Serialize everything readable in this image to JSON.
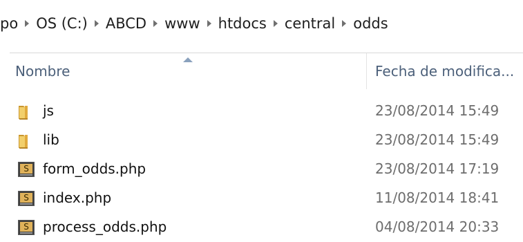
{
  "breadcrumb": {
    "items": [
      "po",
      "OS (C:)",
      "ABCD",
      "www",
      "htdocs",
      "central",
      "odds"
    ]
  },
  "columns": {
    "name": "Nombre",
    "date": "Fecha de modifica..."
  },
  "files": [
    {
      "name": "js",
      "date": "23/08/2014 15:49",
      "icon": "folder-icon"
    },
    {
      "name": "lib",
      "date": "23/08/2014 15:49",
      "icon": "folder-icon"
    },
    {
      "name": "form_odds.php",
      "date": "23/08/2014 17:19",
      "icon": "php-file-icon"
    },
    {
      "name": "index.php",
      "date": "11/08/2014 18:41",
      "icon": "php-file-icon"
    },
    {
      "name": "process_odds.php",
      "date": "04/08/2014 20:33",
      "icon": "php-file-icon"
    }
  ],
  "colors": {
    "header_text": "#4c607a",
    "folder": "#e8b84a",
    "php_icon": "#4a4a4a"
  }
}
